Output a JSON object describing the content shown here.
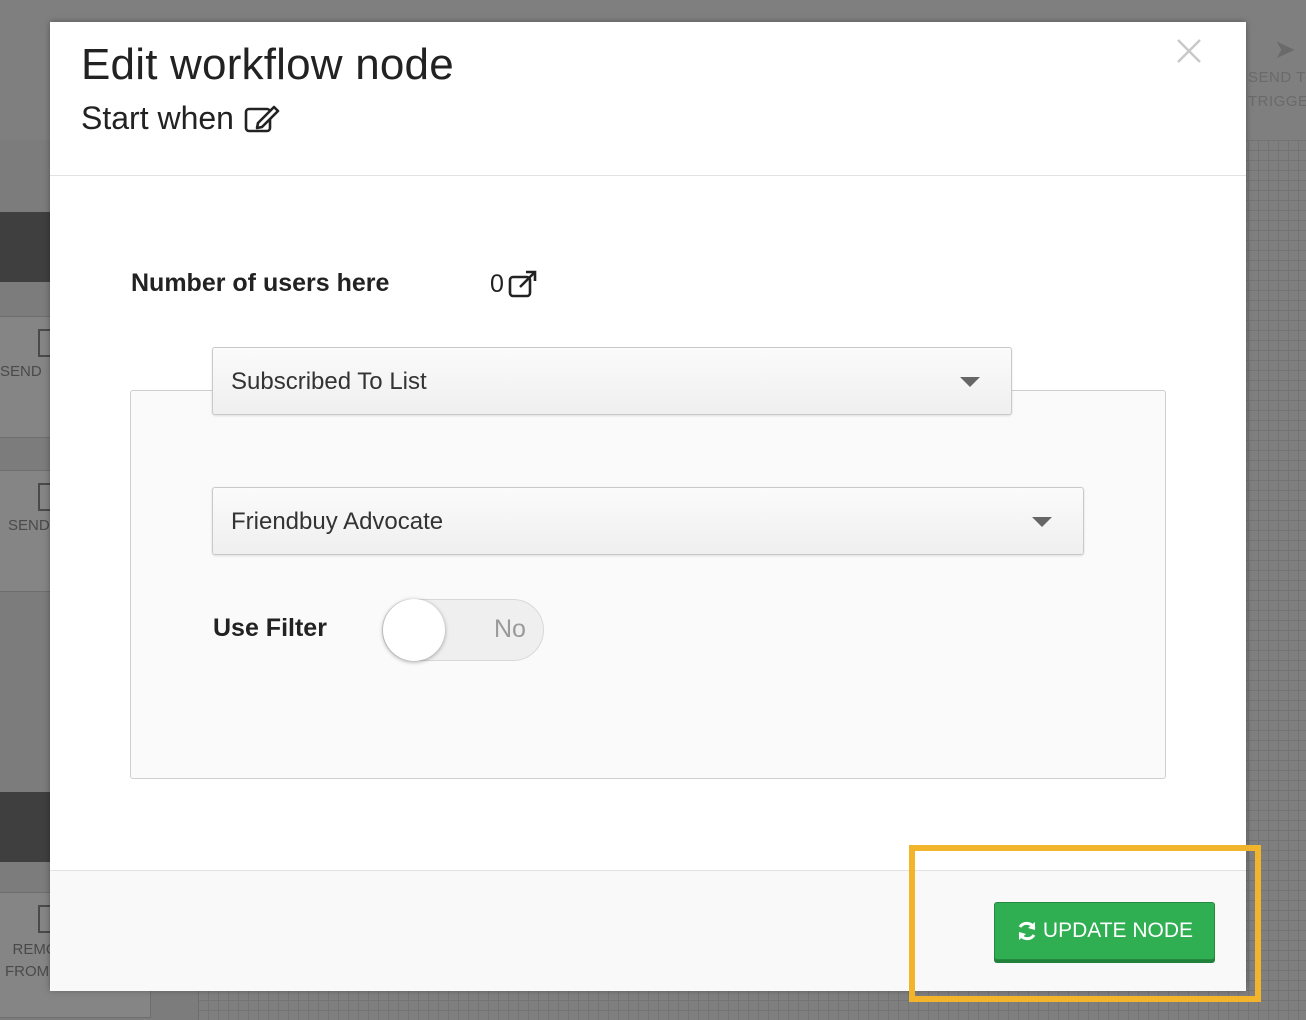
{
  "background": {
    "sidebar_cards": [
      "SEND",
      "SEND",
      "REMOVE FROM LIST"
    ],
    "right_label_line1": "SEND T",
    "right_label_line2": "TRIGGE"
  },
  "modal": {
    "title": "Edit workflow node",
    "subtitle": "Start when",
    "users_label": "Number of users here",
    "users_count": "0",
    "trigger_select": {
      "value": "Subscribed To List"
    },
    "list_select": {
      "value": "Friendbuy Advocate"
    },
    "use_filter": {
      "label": "Use Filter",
      "state_text": "No",
      "on": false
    },
    "update_button_label": "UPDATE NODE"
  },
  "colors": {
    "primary_button": "#2fae52",
    "highlight": "#f2b42a"
  },
  "icons": [
    "close-icon",
    "edit-icon",
    "external-link-icon",
    "refresh-icon",
    "caret-down-icon"
  ]
}
